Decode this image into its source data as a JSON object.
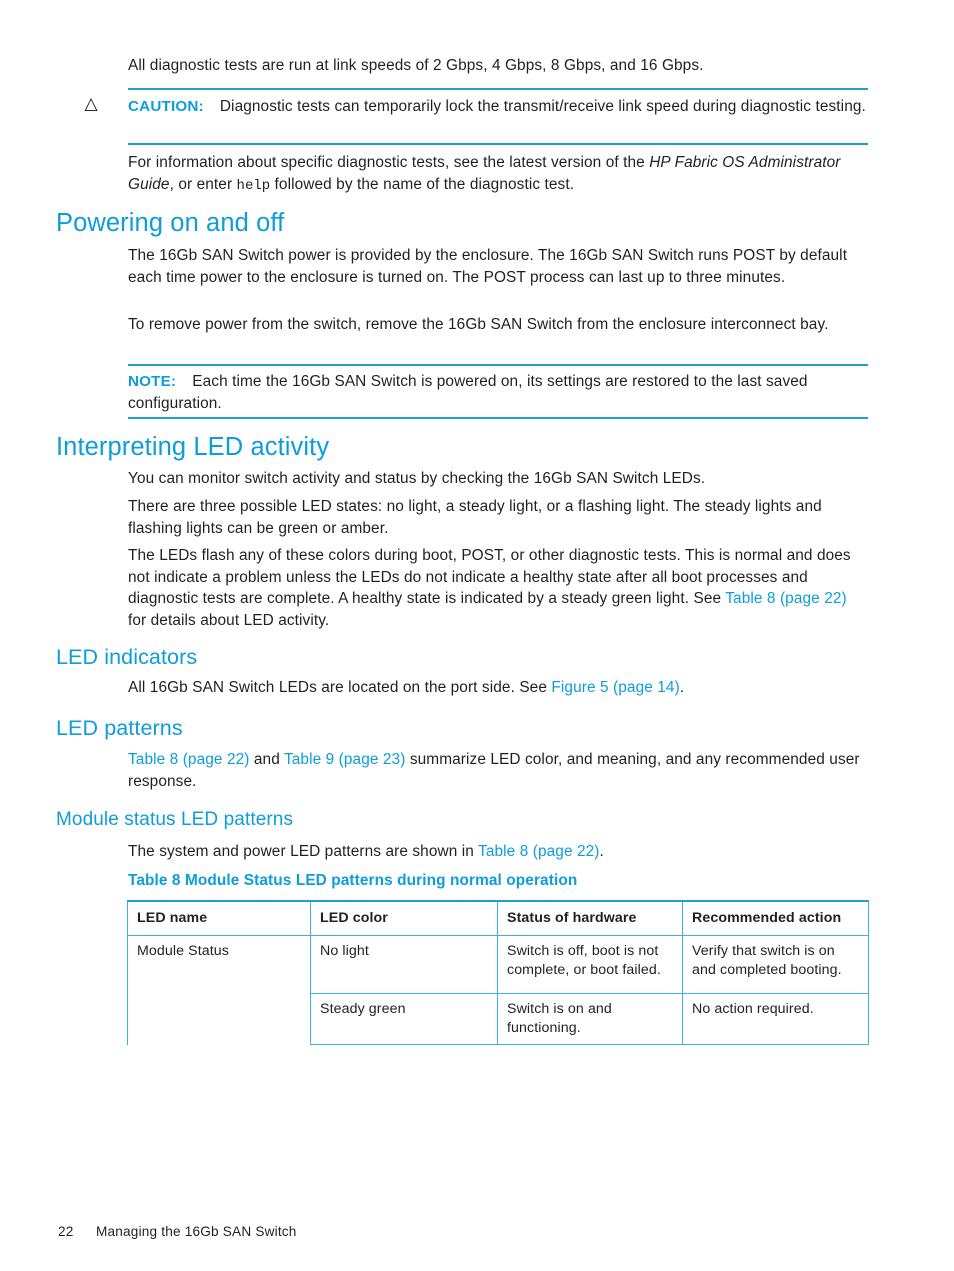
{
  "page": {
    "intro_paragraph": "All diagnostic tests are run at link speeds of 2 Gbps, 4 Gbps, 8 Gbps, and 16 Gbps."
  },
  "caution": {
    "icon": "warning-triangle-icon",
    "label": "CAUTION:",
    "text": "Diagnostic tests can temporarily lock the transmit/receive link speed during diagnostic testing."
  },
  "para_diag_info": {
    "lead": "For information about specific diagnostic tests, see the latest version of the ",
    "italic_title": "HP Fabric OS Administrator Guide",
    "mid": ", or enter ",
    "mono_cmd": "help",
    "tail": " followed by the name of the diagnostic test."
  },
  "section_power": {
    "heading": "Powering on and off",
    "para1": "The 16Gb SAN Switch power is provided by the enclosure. The 16Gb SAN Switch runs POST by default each time power to the enclosure is turned on. The POST process can last up to three minutes.",
    "para2": "To remove power from the switch, remove the 16Gb SAN Switch from the enclosure interconnect bay."
  },
  "note": {
    "label": "NOTE:",
    "text": "Each time the 16Gb SAN Switch is powered on, its settings are restored to the last saved configuration."
  },
  "section_led": {
    "heading": "Interpreting LED activity",
    "para1": "You can monitor switch activity and status by checking the 16Gb SAN Switch LEDs.",
    "para2": "There are three possible LED states: no light, a steady light, or a flashing light. The steady lights and flashing lights can be green or amber.",
    "para3_lead": "The LEDs flash any of these colors during boot, POST, or other diagnostic tests. This is normal and does not indicate a problem unless the LEDs do not indicate a healthy state after all boot processes and diagnostic tests are complete. A healthy state is indicated by a steady green light. See ",
    "para3_link": "Table 8 (page 22)",
    "para3_tail": " for details about LED activity."
  },
  "section_led_indicators": {
    "heading": "LED indicators",
    "para_lead": "All 16Gb SAN Switch LEDs are located on the port side. See ",
    "para_link": "Figure 5 (page 14)",
    "para_tail": "."
  },
  "section_led_patterns": {
    "heading": "LED patterns",
    "link1": "Table 8 (page 22)",
    "conj": " and ",
    "link2": "Table 9 (page 23)",
    "tail": " summarize LED color, and meaning, and any recommended user response."
  },
  "section_module_status": {
    "heading": "Module status LED patterns",
    "para_lead": "The system and power LED patterns are shown in ",
    "para_link": "Table 8 (page 22)",
    "para_tail": "."
  },
  "table8": {
    "caption": "Table 8 Module Status LED patterns during normal operation",
    "columns": [
      "LED name",
      "LED color",
      "Status of hardware",
      "Recommended action"
    ],
    "rows": [
      {
        "led_name": "Module Status",
        "led_color": "No light",
        "status": "Switch is off, boot is not complete, or boot failed.",
        "action": "Verify that switch is on and completed booting."
      },
      {
        "led_name": "",
        "led_color": "Steady green",
        "status": "Switch is on and functioning.",
        "action": "No action required."
      }
    ]
  },
  "footer": {
    "page_number": "22",
    "chapter": "Managing the 16Gb SAN Switch"
  },
  "colors": {
    "heading_blue": "#0d9ddb",
    "link_blue": "#0d9ddb",
    "rule_blue": "#1f9fd4",
    "table_border": "#3bb3e0",
    "body_text": "#231f20"
  }
}
